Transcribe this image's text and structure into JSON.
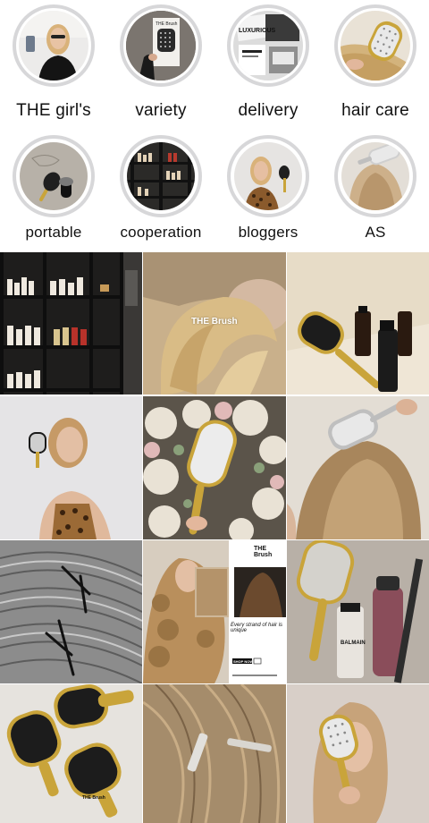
{
  "highlights": [
    {
      "label": "THE girl's"
    },
    {
      "label": "variety"
    },
    {
      "label": "delivery"
    },
    {
      "label": "hair care"
    },
    {
      "label": "portable"
    },
    {
      "label": "cooperation"
    },
    {
      "label": "bloggers"
    },
    {
      "label": "AS"
    }
  ],
  "highlight_images": {
    "variety_box": "THE Brush",
    "delivery_box": "LUXURIOUS"
  },
  "posts": {
    "post_2_overlay": "THE Brush",
    "post_8_header": "THE Brush",
    "post_8_caption": "Every strand of hair is unique",
    "post_8_button": "SHOP NOW",
    "post_9_bottle": "BALMAIN",
    "post_10_brush": "THE Brush"
  },
  "colors": {
    "ring": "#d7d7d9",
    "gold": "#c9a43a",
    "black": "#1a1a1a"
  }
}
